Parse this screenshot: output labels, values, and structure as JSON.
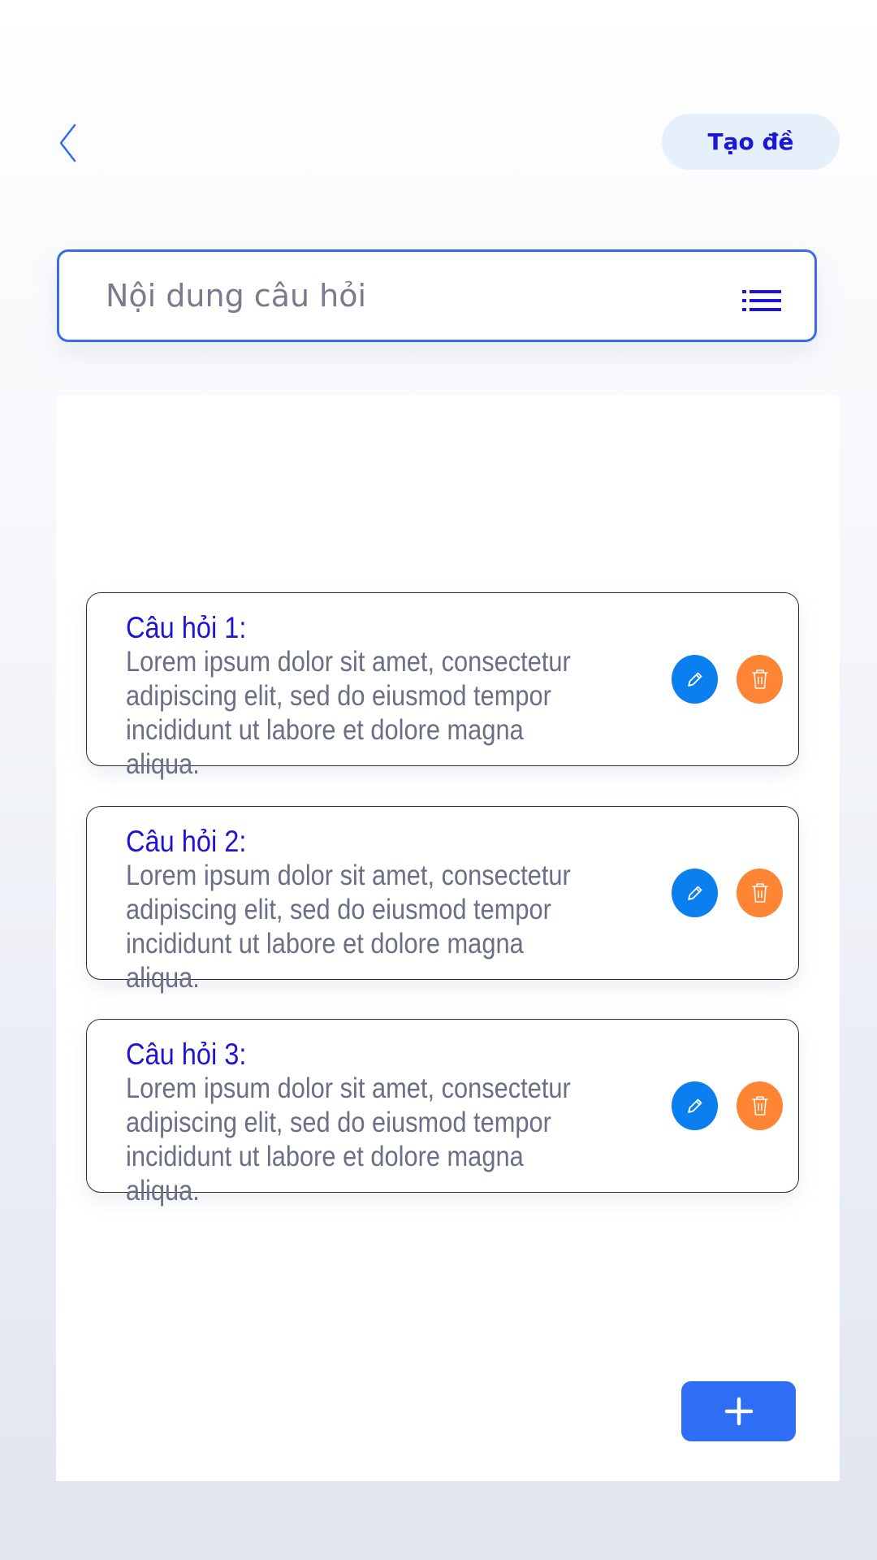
{
  "header": {
    "back_icon": "chevron-left-icon",
    "create_label": "Tạo đề"
  },
  "search": {
    "placeholder": "Nội dung câu hỏi",
    "value": "",
    "menu_icon": "list-icon"
  },
  "questions": [
    {
      "title": "Câu hỏi 1:",
      "body": "Lorem ipsum dolor sit amet, consectetur adipiscing elit, sed do eiusmod tempor incididunt ut labore et dolore magna aliqua."
    },
    {
      "title": "Câu hỏi 2:",
      "body": "Lorem ipsum dolor sit amet, consectetur adipiscing elit, sed do eiusmod tempor incididunt ut labore et dolore magna aliqua."
    },
    {
      "title": "Câu hỏi 3:",
      "body": "Lorem ipsum dolor sit amet, consectetur adipiscing elit, sed do eiusmod tempor incididunt ut labore et dolore magna aliqua."
    }
  ],
  "actions": {
    "edit_icon": "pencil-icon",
    "delete_icon": "trash-icon",
    "add_icon": "plus-icon"
  },
  "colors": {
    "accent": "#2f6df5",
    "title": "#1f14d6",
    "edit": "#0b7ef0",
    "delete": "#fd8533",
    "create_bg": "#e6f0fb"
  }
}
